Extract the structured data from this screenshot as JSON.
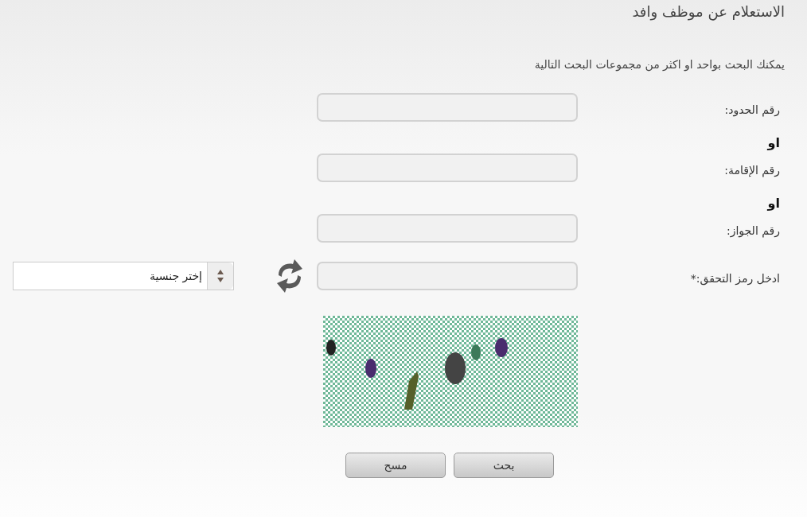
{
  "title": "الاستعلام عن موظف وافد",
  "intro": "يمكنك البحث بواحد او اكثر من مجموعات البحث التالية",
  "rows": [
    {
      "kind": "field",
      "label": "رقم الحدود:"
    },
    {
      "kind": "or",
      "text": "او"
    },
    {
      "kind": "field",
      "label": "رقم الإقامة:"
    },
    {
      "kind": "or",
      "text": "او"
    },
    {
      "kind": "field",
      "label": "رقم الجواز:"
    }
  ],
  "captcha": {
    "label": "ادخل رمز التحقق:*",
    "kind": "picture"
  },
  "nationality": {
    "value": "إختر جنسية"
  },
  "buttons": [
    "بحث",
    "مسح"
  ]
}
